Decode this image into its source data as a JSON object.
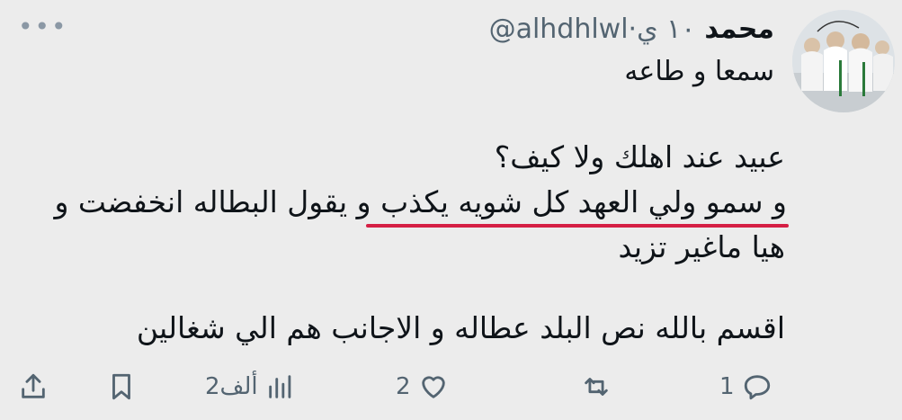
{
  "author": {
    "display_name": "محمد",
    "handle_meta": "@alhdhlwl·١٠ ي"
  },
  "reply_text": "سمعا و طاعه",
  "body": {
    "line1": "عبيد عند اهلك ولا كيف؟",
    "line2": "و سمو ولي العهد كل شويه يكذب و يقول البطاله انخفضت و",
    "line3": "هيا ماغير تزيد",
    "line4": "اقسم بالله نص البلد عطاله و الاجانب هم الي شغالين"
  },
  "actions": {
    "reply_count": "1",
    "like_count": "2",
    "views_count": "2ألف"
  },
  "colors": {
    "underline": "#d51f44",
    "icon": "#536471"
  }
}
